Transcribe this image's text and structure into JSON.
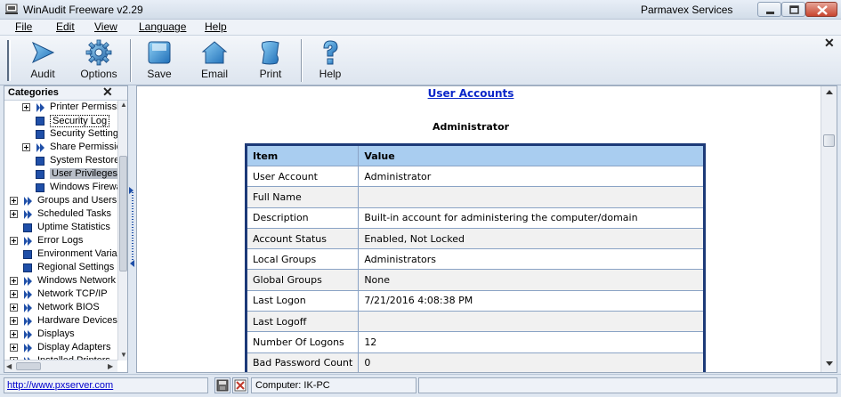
{
  "window": {
    "title": "WinAudit Freeware v2.29",
    "vendor": "Parmavex Services"
  },
  "menu": [
    {
      "label": "File",
      "key": "F"
    },
    {
      "label": "Edit",
      "key": "E"
    },
    {
      "label": "View",
      "key": "V"
    },
    {
      "label": "Language",
      "key": "L"
    },
    {
      "label": "Help",
      "key": "H"
    }
  ],
  "toolbar": {
    "audit": "Audit",
    "options": "Options",
    "save": "Save",
    "email": "Email",
    "print": "Print",
    "help": "Help"
  },
  "categories": {
    "title": "Categories",
    "items": [
      {
        "label": "Printer Permissic",
        "expandable": true,
        "indent": 1
      },
      {
        "label": "Security Log",
        "expandable": false,
        "indent": 1,
        "focused": true
      },
      {
        "label": "Security Setting",
        "expandable": false,
        "indent": 1
      },
      {
        "label": "Share Permissic",
        "expandable": true,
        "indent": 1
      },
      {
        "label": "System Restore",
        "expandable": false,
        "indent": 1
      },
      {
        "label": "User Privileges",
        "expandable": false,
        "indent": 1,
        "selected": true
      },
      {
        "label": "Windows Firewa",
        "expandable": false,
        "indent": 1
      },
      {
        "label": "Groups and Users",
        "expandable": true,
        "indent": 0
      },
      {
        "label": "Scheduled Tasks",
        "expandable": true,
        "indent": 0
      },
      {
        "label": "Uptime Statistics",
        "expandable": false,
        "indent": 0
      },
      {
        "label": "Error Logs",
        "expandable": true,
        "indent": 0
      },
      {
        "label": "Environment Variab",
        "expandable": false,
        "indent": 0
      },
      {
        "label": "Regional Settings",
        "expandable": false,
        "indent": 0
      },
      {
        "label": "Windows Network",
        "expandable": true,
        "indent": 0
      },
      {
        "label": "Network TCP/IP",
        "expandable": true,
        "indent": 0
      },
      {
        "label": "Network BIOS",
        "expandable": true,
        "indent": 0
      },
      {
        "label": "Hardware Devices",
        "expandable": true,
        "indent": 0
      },
      {
        "label": "Displays",
        "expandable": true,
        "indent": 0
      },
      {
        "label": "Display Adapters",
        "expandable": true,
        "indent": 0
      },
      {
        "label": "Installed Printers",
        "expandable": true,
        "indent": 0
      }
    ]
  },
  "content": {
    "section_title": "User Accounts",
    "account_name": "Administrator",
    "table": {
      "headers": [
        "Item",
        "Value"
      ],
      "rows": [
        [
          "User Account",
          "Administrator"
        ],
        [
          "Full Name",
          ""
        ],
        [
          "Description",
          "Built-in account for administering the computer/domain"
        ],
        [
          "Account Status",
          "Enabled, Not Locked"
        ],
        [
          "Local Groups",
          "Administrators"
        ],
        [
          "Global Groups",
          "None"
        ],
        [
          "Last Logon",
          "7/21/2016 4:08:38 PM"
        ],
        [
          "Last Logoff",
          ""
        ],
        [
          "Number Of Logons",
          "12"
        ],
        [
          "Bad Password Count",
          "0"
        ]
      ]
    }
  },
  "status": {
    "link": "http://www.pxserver.com",
    "computer": "Computer: IK-PC"
  },
  "colors": {
    "link": "#0b27c9",
    "table_header": "#a9cdf0",
    "table_border": "#1d3a78",
    "tree_icon": "#1f4fa8"
  }
}
